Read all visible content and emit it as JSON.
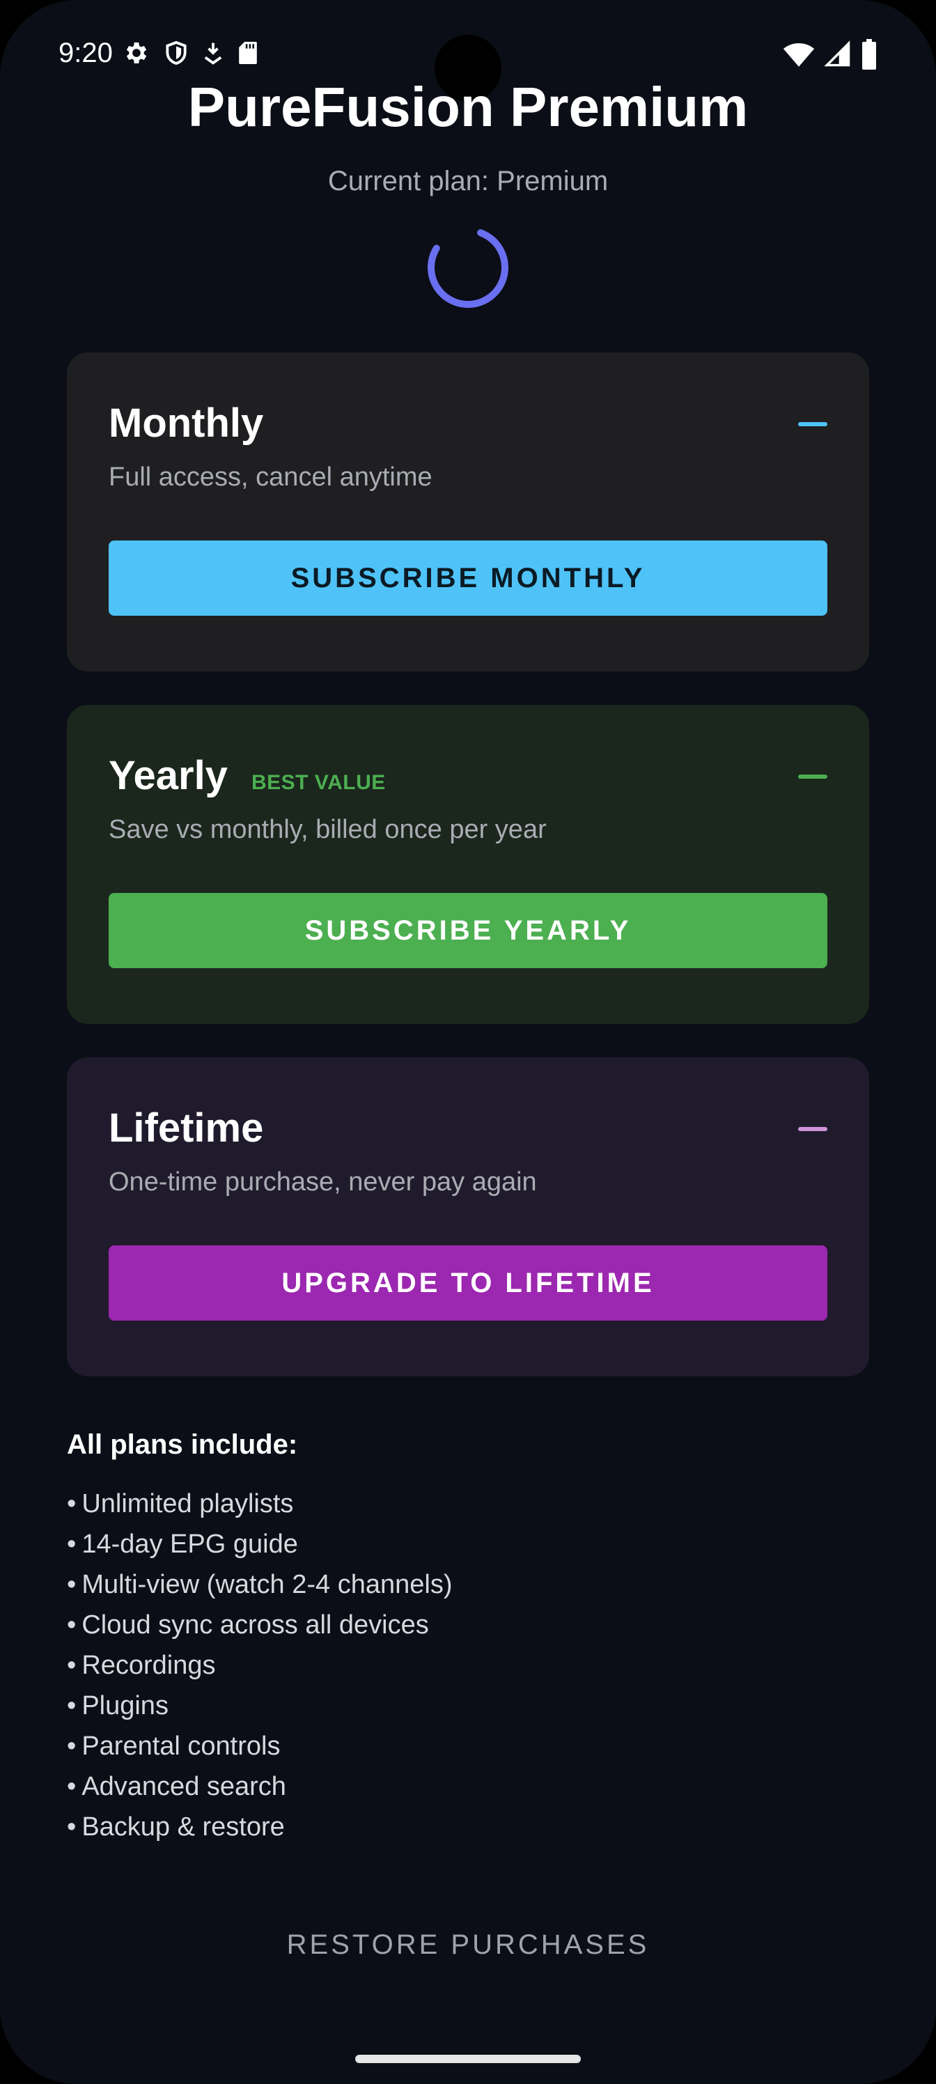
{
  "status_bar": {
    "time": "9:20",
    "left_icons": [
      "settings-icon",
      "shield-icon",
      "download-icon",
      "sd-card-icon"
    ],
    "right_icons": [
      "wifi-icon",
      "cellular-signal-icon",
      "battery-icon"
    ]
  },
  "header": {
    "title": "PureFusion Premium",
    "subtitle": "Current plan: Premium",
    "loading": true
  },
  "plans": [
    {
      "id": "monthly",
      "title": "Monthly",
      "badge": "",
      "description": "Full access, cancel anytime",
      "button_label": "SUBSCRIBE MONTHLY",
      "accent": "#4fc3f7",
      "card_bg": "#1f1f21"
    },
    {
      "id": "yearly",
      "title": "Yearly",
      "badge": "BEST VALUE",
      "description": "Save vs monthly, billed once per year",
      "button_label": "SUBSCRIBE YEARLY",
      "accent": "#4caf50",
      "card_bg": "#1b261d"
    },
    {
      "id": "lifetime",
      "title": "Lifetime",
      "badge": "",
      "description": "One-time purchase, never pay again",
      "button_label": "UPGRADE TO LIFETIME",
      "accent": "#9c27b0",
      "dash_color": "#ce93d8",
      "card_bg": "#201b2c"
    }
  ],
  "features": {
    "title": "All plans include:",
    "bullet": "•",
    "items": [
      "Unlimited playlists",
      "14-day EPG guide",
      "Multi-view (watch 2-4 channels)",
      "Cloud sync across all devices",
      "Recordings",
      "Plugins",
      "Parental controls",
      "Advanced search",
      "Backup & restore"
    ]
  },
  "footer": {
    "restore_label": "RESTORE PURCHASES"
  },
  "colors": {
    "background": "#0b0e16",
    "spinner": "#6a6ff0"
  }
}
